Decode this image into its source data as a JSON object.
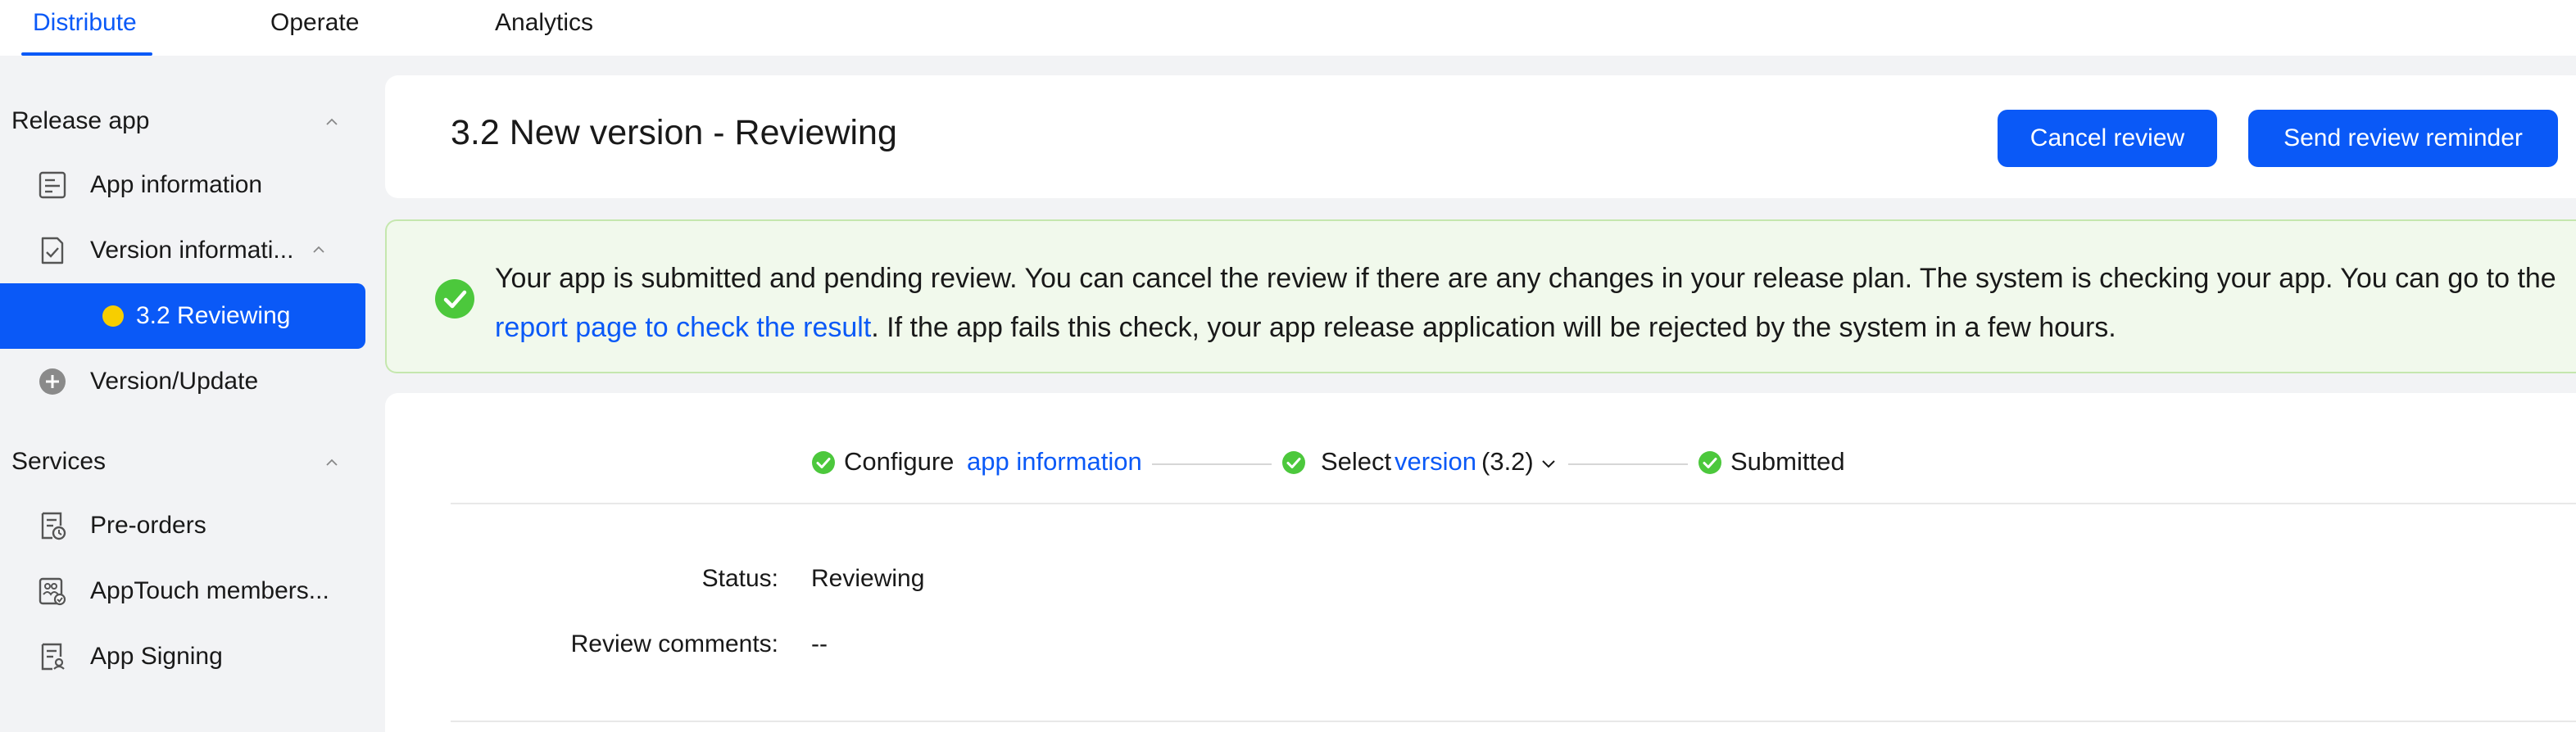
{
  "colors": {
    "accent": "#0a59f7",
    "success": "#4cc83c",
    "warning_dot": "#f7ce00",
    "notice_bg": "#f1f9ec",
    "notice_border": "#c5e7ae"
  },
  "topnav": {
    "tabs": [
      {
        "label": "Distribute",
        "active": true
      },
      {
        "label": "Operate",
        "active": false
      },
      {
        "label": "Analytics",
        "active": false
      }
    ]
  },
  "sidebar": {
    "sections": [
      {
        "title": "Release app",
        "items": [
          {
            "label": "App information",
            "icon": "app-info-icon"
          },
          {
            "label": "Version informati...",
            "icon": "version-info-icon"
          },
          {
            "label": "3.2 Reviewing",
            "icon": "status-dot",
            "active": true
          },
          {
            "label": "Version/Update",
            "icon": "add-circle-icon"
          }
        ]
      },
      {
        "title": "Services",
        "items": [
          {
            "label": "Pre-orders",
            "icon": "pre-orders-icon"
          },
          {
            "label": "AppTouch members...",
            "icon": "members-icon"
          },
          {
            "label": "App Signing",
            "icon": "app-signing-icon"
          }
        ]
      }
    ]
  },
  "header": {
    "title": "3.2 New version - Reviewing",
    "cancel_label": "Cancel review",
    "reminder_label": "Send review reminder"
  },
  "notice": {
    "line1": "Your app is submitted and pending review. You can cancel the review if there are any changes in your release plan. The system is checking your app. You can go to the",
    "link": "report page to check the result",
    "line2_rest": ". If the app fails this check, your app release application will be rejected by the system in a few hours."
  },
  "steps": {
    "step1_text": "Configure",
    "step1_link": "app information",
    "step2_text": "Select",
    "step2_link": "version",
    "step2_value": "(3.2)",
    "step3_text": "Submitted"
  },
  "details": {
    "status_label": "Status:",
    "status_value": "Reviewing",
    "comments_label": "Review comments:",
    "comments_value": "--"
  }
}
